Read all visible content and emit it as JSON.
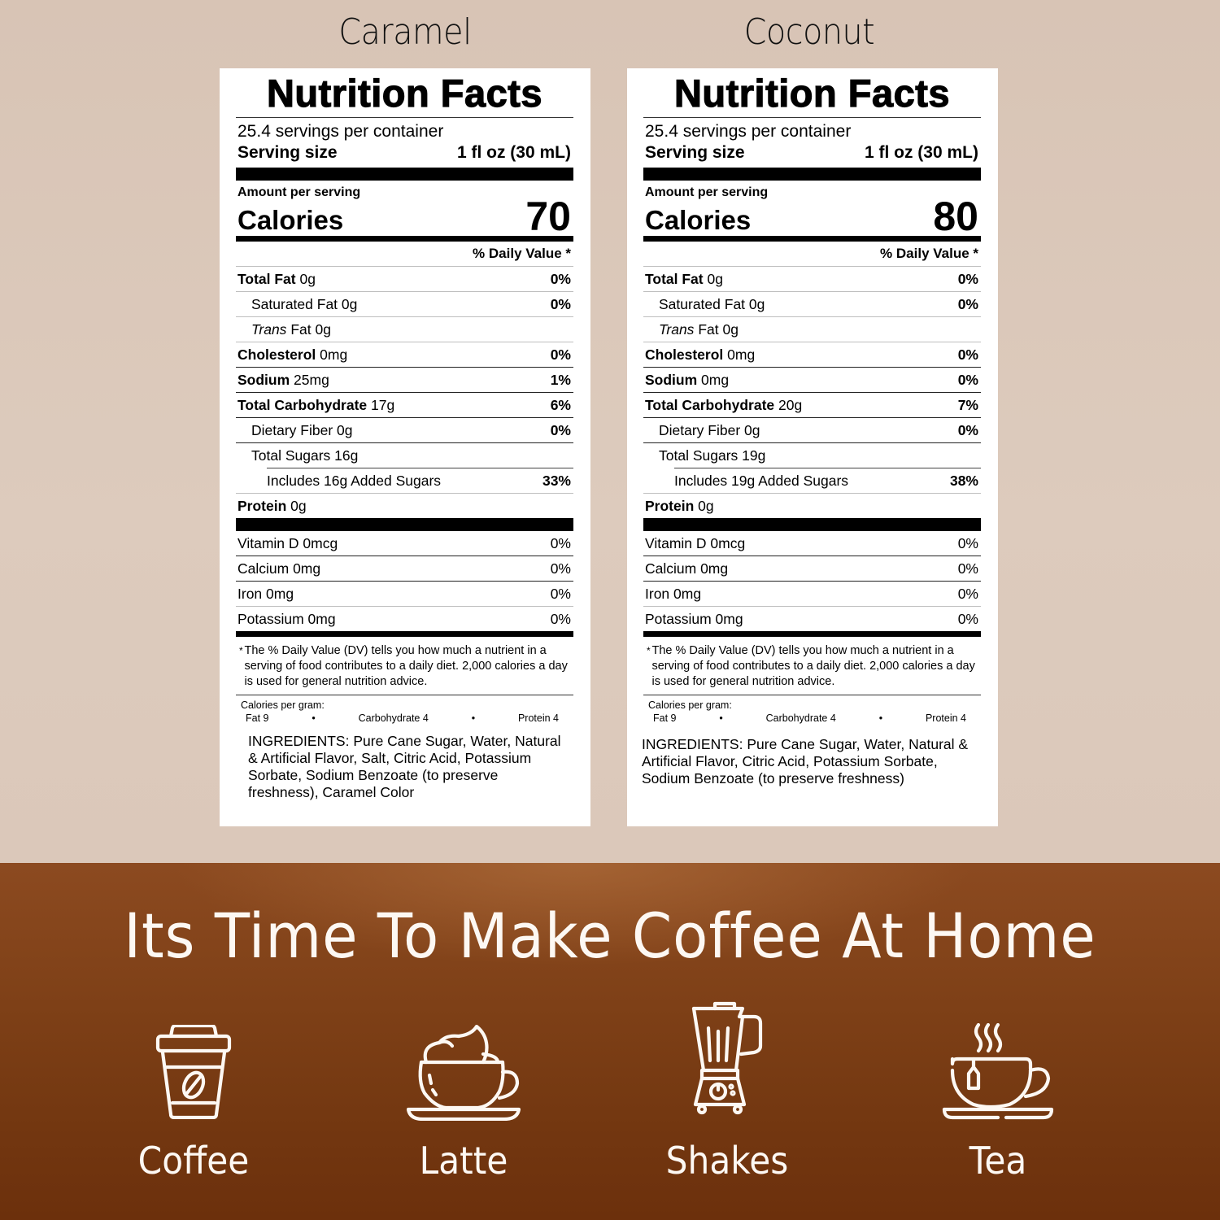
{
  "flavors": [
    {
      "title": "Caramel",
      "label": {
        "heading": "Nutrition Facts",
        "servings_per_container": "25.4 servings per container",
        "serving_size_label": "Serving size",
        "serving_size_value": "1 fl oz (30 mL)",
        "amount_per_serving": "Amount per serving",
        "calories_label": "Calories",
        "calories_value": "70",
        "daily_value_header": "% Daily Value *",
        "nutrients": [
          {
            "name": "Total Fat",
            "amount": "0g",
            "dv": "0%"
          },
          {
            "name": "Saturated Fat",
            "amount": "0g",
            "dv": "0%"
          },
          {
            "name": "Trans",
            "suffix": "Fat 0g",
            "dv": ""
          },
          {
            "name": "Cholesterol",
            "amount": "0mg",
            "dv": "0%"
          },
          {
            "name": "Sodium",
            "amount": "25mg",
            "dv": "1%"
          },
          {
            "name": "Total Carbohydrate",
            "amount": "17g",
            "dv": "6%"
          },
          {
            "name": "Dietary Fiber",
            "amount": "0g",
            "dv": "0%"
          },
          {
            "name": "Total Sugars",
            "amount": "16g",
            "dv": ""
          },
          {
            "name": "Includes 16g Added Sugars",
            "amount": "",
            "dv": "33%"
          },
          {
            "name": "Protein",
            "amount": "0g",
            "dv": ""
          }
        ],
        "vitamins": [
          {
            "text": "Vitamin D 0mcg",
            "dv": "0%"
          },
          {
            "text": "Calcium 0mg",
            "dv": "0%"
          },
          {
            "text": "Iron 0mg",
            "dv": "0%"
          },
          {
            "text": "Potassium 0mg",
            "dv": "0%"
          }
        ],
        "footnote_asterisk": "*",
        "footnote": "The % Daily Value (DV) tells you how much a nutrient in a serving of food contributes to a daily diet. 2,000 calories a day is used for general nutrition advice.",
        "calories_per_gram_label": "Calories per gram:",
        "calories_per_gram": [
          "Fat 9",
          "•",
          "Carbohydrate 4",
          "•",
          "Protein 4"
        ],
        "ingredients_label": "INGREDIENTS:",
        "ingredients": "Pure Cane Sugar, Water, Natural & Artificial Flavor, Salt, Citric Acid, Potassium Sorbate, Sodium Benzoate (to preserve freshness), Caramel Color"
      }
    },
    {
      "title": "Coconut",
      "label": {
        "heading": "Nutrition Facts",
        "servings_per_container": "25.4 servings per container",
        "serving_size_label": "Serving size",
        "serving_size_value": "1 fl oz (30 mL)",
        "amount_per_serving": "Amount per serving",
        "calories_label": "Calories",
        "calories_value": "80",
        "daily_value_header": "% Daily Value *",
        "nutrients": [
          {
            "name": "Total Fat",
            "amount": "0g",
            "dv": "0%"
          },
          {
            "name": "Saturated Fat",
            "amount": "0g",
            "dv": "0%"
          },
          {
            "name": "Trans",
            "suffix": "Fat 0g",
            "dv": ""
          },
          {
            "name": "Cholesterol",
            "amount": "0mg",
            "dv": "0%"
          },
          {
            "name": "Sodium",
            "amount": "0mg",
            "dv": "0%"
          },
          {
            "name": "Total Carbohydrate",
            "amount": "20g",
            "dv": "7%"
          },
          {
            "name": "Dietary Fiber",
            "amount": "0g",
            "dv": "0%"
          },
          {
            "name": "Total Sugars",
            "amount": "19g",
            "dv": ""
          },
          {
            "name": "Includes 19g Added Sugars",
            "amount": "",
            "dv": "38%"
          },
          {
            "name": "Protein",
            "amount": "0g",
            "dv": ""
          }
        ],
        "vitamins": [
          {
            "text": "Vitamin D 0mcg",
            "dv": "0%"
          },
          {
            "text": "Calcium 0mg",
            "dv": "0%"
          },
          {
            "text": "Iron 0mg",
            "dv": "0%"
          },
          {
            "text": "Potassium 0mg",
            "dv": "0%"
          }
        ],
        "footnote_asterisk": "*",
        "footnote": "The % Daily Value (DV) tells you how much a nutrient in a serving of food contributes to a daily diet. 2,000 calories a day is used for general nutrition advice.",
        "calories_per_gram_label": "Calories per gram:",
        "calories_per_gram": [
          "Fat 9",
          "•",
          "Carbohydrate 4",
          "•",
          "Protein 4"
        ],
        "ingredients_label": "INGREDIENTS:",
        "ingredients": "Pure Cane Sugar, Water, Natural & Artificial Flavor, Citric Acid, Potassium Sorbate, Sodium Benzoate (to preserve freshness)"
      }
    }
  ],
  "banner": {
    "slogan": "Its Time To Make Coffee At Home",
    "drinks": [
      {
        "name": "Coffee",
        "icon": "takeaway-coffee-cup-icon"
      },
      {
        "name": "Latte",
        "icon": "latte-cup-icon"
      },
      {
        "name": "Shakes",
        "icon": "blender-icon"
      },
      {
        "name": "Tea",
        "icon": "tea-cup-icon"
      }
    ]
  },
  "colors": {
    "page_background": "#dccabc",
    "banner_brown": "#7e4017",
    "banner_text": "#fdf8f3",
    "label_background": "#ffffff"
  }
}
